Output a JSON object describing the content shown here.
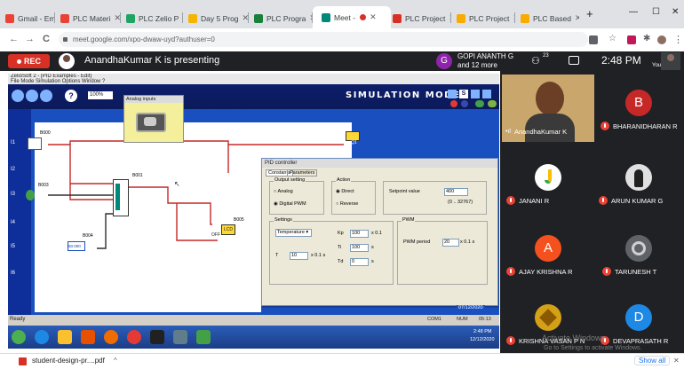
{
  "browser": {
    "tabs": [
      {
        "label": "Gmail - Em",
        "color": "#ea4335"
      },
      {
        "label": "PLC Materi",
        "color": "#ea4335"
      },
      {
        "label": "PLC Zelio P",
        "color": "#1fa463"
      },
      {
        "label": "Day 5 Prog",
        "color": "#f4b400"
      },
      {
        "label": "PLC Progra",
        "color": "#188038"
      },
      {
        "label": "Meet -",
        "color": "#00897b"
      },
      {
        "label": "PLC Project",
        "color": "#d93025"
      },
      {
        "label": "PLC Project",
        "color": "#f9ab00"
      },
      {
        "label": "PLC Based",
        "color": "#f9ab00"
      }
    ],
    "new_tab": "+",
    "controls": [
      "—",
      "☐",
      "✕"
    ],
    "url": "meet.google.com/xpo-dwaw-uyd?authuser=0",
    "nav_back": "←",
    "nav_forward": "→",
    "nav_reload": "C"
  },
  "meet": {
    "rec_label": "REC",
    "presenting_text": "AnandhaKumar K is presenting",
    "host_initial": "G",
    "host_name": "GOPI ANANTH G",
    "host_more": "and 12 more",
    "participant_count": "23",
    "time": "2:48 PM",
    "you_label": "You",
    "colors": {
      "rec": "#d93025",
      "host": "#8e24aa",
      "bar": "#202124"
    }
  },
  "zelio": {
    "window_title": "ZelioSoft 2 - [PID Examples - Edit]",
    "menu": "File   Mode   Simulation   Options   Window   ?",
    "zoom": "100%",
    "mode_label": "SIMULATION MODE",
    "analog_inputs_title": "Analog inputs",
    "blocks": {
      "b000": "B000",
      "b001": "B001",
      "b003": "B003",
      "b004": "B004",
      "b005": "B005",
      "q1_label": "Q1",
      "b004_value": "50.000",
      "lcd": "LCD",
      "off": "OFF"
    },
    "pid": {
      "title": "PID controller",
      "tabs": [
        "Constants",
        "Parameters"
      ],
      "output_setting": "Output setting",
      "analog": "Analog",
      "digital_pwm": "Digital PWM",
      "action": "Action",
      "direct": "Direct",
      "reverse": "Reverse",
      "setpoint_label": "Setpoint value",
      "setpoint_value": "400",
      "setpoint_range": "(0 .. 32767)",
      "settings": "Settings",
      "temperature": "Temperature",
      "kp_label": "Kp",
      "kp_value": "100",
      "kp_unit": "x 0.1",
      "ti_label": "Ti",
      "ti_value": "100",
      "ti_unit": "s",
      "td_label": "Td",
      "td_value": "0",
      "td_unit": "s",
      "t_label": "T",
      "t_value": "10",
      "t_unit": "x 0.1 s",
      "pwm": "PWM",
      "pwm_period": "PWM period",
      "pwm_value": "20",
      "pwm_unit": "x 0.1 s"
    },
    "status": {
      "ready": "Ready",
      "date": "07/12/2020",
      "com": "COM1",
      "num": "NUM",
      "clock": "05:13"
    },
    "taskbar_time": "2:48 PM",
    "taskbar_date": "12/12/2020"
  },
  "presenter": {
    "name": "AnandhaKumar K"
  },
  "participants": [
    {
      "name": "BHARANIDHARAN R",
      "initial": "B",
      "color": "#c62828"
    },
    {
      "name": "JANANI R",
      "initial": "",
      "color": "#ffffff"
    },
    {
      "name": "ARUN KUMAR G",
      "initial": "",
      "color": "#424242"
    },
    {
      "name": "AJAY KRISHNA R",
      "initial": "A",
      "color": "#f4511e"
    },
    {
      "name": "TARUNESH T",
      "initial": "",
      "color": "#5f6368"
    },
    {
      "name": "KRISHNA VASAN P N",
      "initial": "",
      "color": "#b8860b"
    },
    {
      "name": "DEVAPRASATH R",
      "initial": "D",
      "color": "#1e88e5"
    }
  ],
  "watermark": {
    "line1": "Activate Windows",
    "line2": "Go to Settings to activate Windows."
  },
  "download": {
    "file": "student-design-pr....pdf",
    "chevron": "^",
    "show_all": "Show all",
    "close": "✕"
  }
}
